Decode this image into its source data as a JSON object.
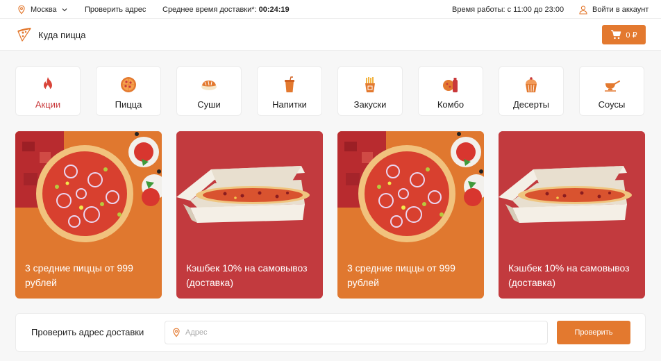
{
  "topbar": {
    "city": "Москва",
    "check_address": "Проверить адрес",
    "avg_delivery_label": "Среднее время доставки*:",
    "avg_delivery_value": "00:24:19",
    "work_hours": "Время работы: с 11:00 до 23:00",
    "login": "Войти в аккаунт"
  },
  "header": {
    "logo_text": "Куда пицца",
    "cart_label": "0 ₽"
  },
  "categories": [
    {
      "label": "Акции",
      "icon": "fire-icon",
      "active": true
    },
    {
      "label": "Пицца",
      "icon": "pizza-icon"
    },
    {
      "label": "Суши",
      "icon": "sushi-icon"
    },
    {
      "label": "Напитки",
      "icon": "drink-icon"
    },
    {
      "label": "Закуски",
      "icon": "fries-icon"
    },
    {
      "label": "Комбо",
      "icon": "combo-icon"
    },
    {
      "label": "Десерты",
      "icon": "cupcake-icon"
    },
    {
      "label": "Соусы",
      "icon": "sauce-icon"
    }
  ],
  "promos": [
    {
      "text": "3 средние пиццы от 999 рублей",
      "color": "#e0782f",
      "image": "pizza-image"
    },
    {
      "text": "Кэшбек 10% на самовывоз (доставка)",
      "color": "#c23a3e",
      "image": "pizza-box-image"
    },
    {
      "text": "3 средние пиццы от 999 рублей",
      "color": "#e0782f",
      "image": "pizza-image"
    },
    {
      "text": "Кэшбек 10% на самовывоз (доставка)",
      "color": "#c23a3e",
      "image": "pizza-box-image"
    }
  ],
  "address_check": {
    "label": "Проверить адрес доставки",
    "placeholder": "Адрес",
    "value": "",
    "button": "Проверить"
  },
  "colors": {
    "accent": "#e3792f",
    "active": "#c9383a"
  }
}
